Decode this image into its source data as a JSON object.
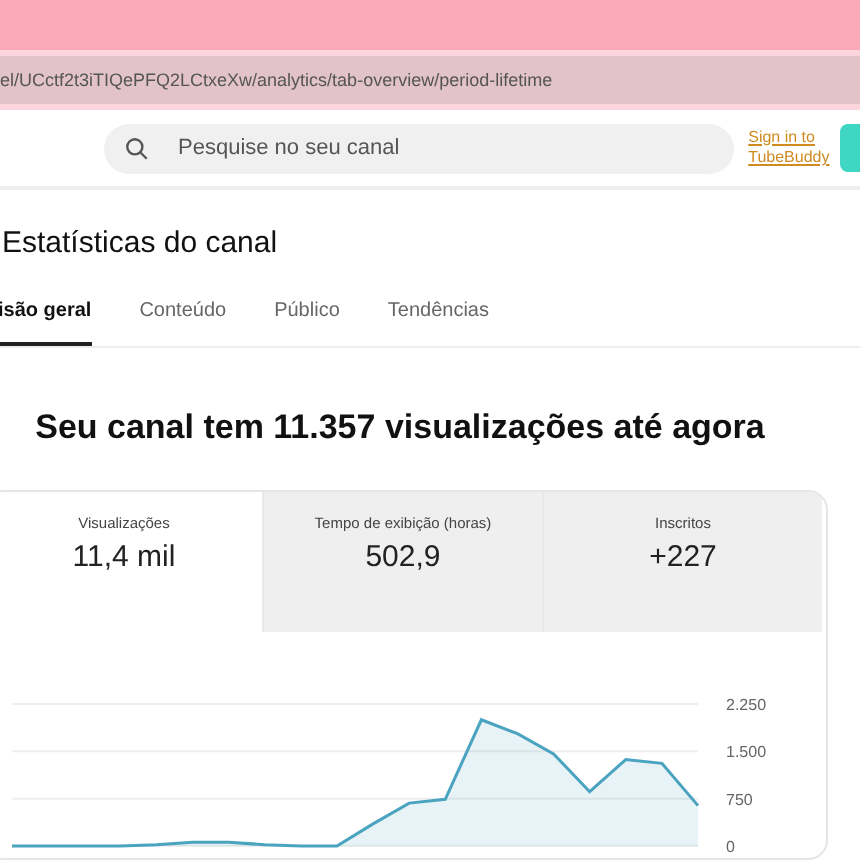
{
  "browser": {
    "url": "el/UCctf2t3iTIQePFQ2LCtxeXw/analytics/tab-overview/period-lifetime"
  },
  "header": {
    "search": {
      "placeholder": "Pesquise no seu canal"
    },
    "signin_link": "Sign in to TubeBuddy"
  },
  "page": {
    "title": "Estatísticas do canal"
  },
  "tabs": [
    {
      "label": "isão geral",
      "selected": true
    },
    {
      "label": "Conteúdo",
      "selected": false
    },
    {
      "label": "Público",
      "selected": false
    },
    {
      "label": "Tendências",
      "selected": false
    }
  ],
  "headline": "Seu canal tem 11.357 visualizações até agora",
  "metrics": [
    {
      "label": "Visualizações",
      "value": "11,4 mil",
      "selected": true
    },
    {
      "label": "Tempo de exibição (horas)",
      "value": "502,9",
      "selected": false
    },
    {
      "label": "Inscritos",
      "value": "+227",
      "selected": false
    }
  ],
  "chart_data": {
    "type": "area",
    "yticks": [
      {
        "value": 0,
        "label": "0"
      },
      {
        "value": 750,
        "label": "750"
      },
      {
        "value": 1500,
        "label": "1.500"
      },
      {
        "value": 2250,
        "label": "2.250"
      }
    ],
    "ylim": [
      0,
      2250
    ],
    "series": [
      {
        "color": "#4aa3bf",
        "values": [
          0,
          0,
          0,
          0,
          20,
          60,
          60,
          20,
          0,
          0,
          350,
          680,
          740,
          2000,
          1780,
          1460,
          860,
          1370,
          1310,
          640
        ]
      }
    ]
  }
}
